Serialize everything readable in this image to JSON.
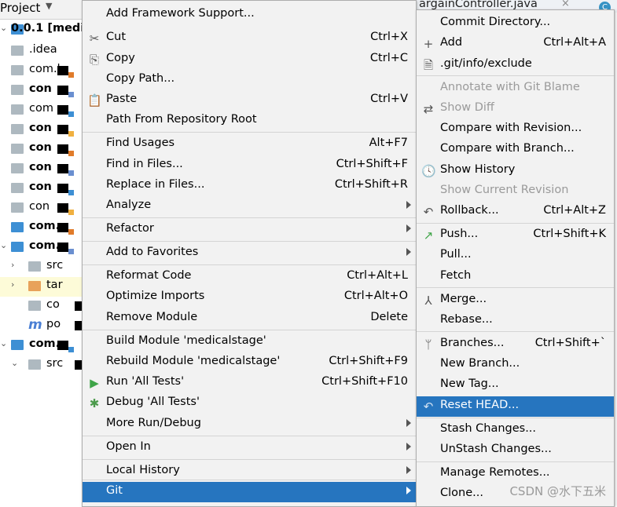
{
  "tree": {
    "title": "Project",
    "rows": [
      {
        "label": "0.0.1 [medic",
        "bold": true
      },
      {
        "label": ".idea"
      },
      {
        "label": "com.h"
      },
      {
        "label": "con",
        "bold": true
      },
      {
        "label": "com"
      },
      {
        "label": "con",
        "bold": true
      },
      {
        "label": "con",
        "bold": true
      },
      {
        "label": "con",
        "bold": true
      },
      {
        "label": "con",
        "bold": true
      },
      {
        "label": "con"
      },
      {
        "label": "com.",
        "bold": true
      },
      {
        "label": "com.",
        "bold": true
      },
      {
        "label": "src"
      },
      {
        "label": "tar"
      },
      {
        "label": "co"
      },
      {
        "label": "po"
      },
      {
        "label": "com.",
        "bold": true
      },
      {
        "label": "src"
      }
    ]
  },
  "editor": {
    "tab_title": "argainController.java",
    "tab_close": "×",
    "tab_badge": "C"
  },
  "main_menu": {
    "items": [
      {
        "label": "Add Framework Support...",
        "shortcut": ""
      },
      {
        "label": "Cut",
        "shortcut": "Ctrl+X",
        "icon": "scissors-icon",
        "glyph": "✂"
      },
      {
        "label": "Copy",
        "shortcut": "Ctrl+C",
        "icon": "copy-icon",
        "glyph": "⎘"
      },
      {
        "label": "Copy Path...",
        "shortcut": ""
      },
      {
        "label": "Paste",
        "shortcut": "Ctrl+V",
        "icon": "clipboard-icon",
        "glyph": "📋"
      },
      {
        "label": "Path From Repository Root",
        "shortcut": ""
      },
      {
        "label": "Find Usages",
        "shortcut": "Alt+F7"
      },
      {
        "label": "Find in Files...",
        "shortcut": "Ctrl+Shift+F"
      },
      {
        "label": "Replace in Files...",
        "shortcut": "Ctrl+Shift+R"
      },
      {
        "label": "Analyze",
        "shortcut": "",
        "submenu": true
      },
      {
        "label": "Refactor",
        "shortcut": "",
        "submenu": true
      },
      {
        "label": "Add to Favorites",
        "shortcut": "",
        "submenu": true
      },
      {
        "label": "Reformat Code",
        "shortcut": "Ctrl+Alt+L"
      },
      {
        "label": "Optimize Imports",
        "shortcut": "Ctrl+Alt+O"
      },
      {
        "label": "Remove Module",
        "shortcut": "Delete"
      },
      {
        "label": "Build Module 'medicalstage'",
        "shortcut": ""
      },
      {
        "label": "Rebuild Module 'medicalstage'",
        "shortcut": "Ctrl+Shift+F9"
      },
      {
        "label": "Run 'All Tests'",
        "shortcut": "Ctrl+Shift+F10",
        "icon": "run-icon",
        "glyph": "▶"
      },
      {
        "label": "Debug 'All Tests'",
        "shortcut": "",
        "icon": "debug-icon",
        "glyph": "✱"
      },
      {
        "label": "More Run/Debug",
        "shortcut": "",
        "submenu": true
      },
      {
        "label": "Open In",
        "shortcut": "",
        "submenu": true
      },
      {
        "label": "Local History",
        "shortcut": "",
        "submenu": true
      },
      {
        "label": "Git",
        "shortcut": "",
        "submenu": true,
        "selected": true
      }
    ]
  },
  "git_menu": {
    "items": [
      {
        "label": "Commit Directory...",
        "shortcut": ""
      },
      {
        "label": "Add",
        "shortcut": "Ctrl+Alt+A",
        "icon": "plus-icon",
        "glyph": "+"
      },
      {
        "label": ".git/info/exclude",
        "shortcut": "",
        "icon": "file-icon",
        "glyph": "🗎"
      },
      {
        "label": "Annotate with Git Blame",
        "shortcut": "",
        "disabled": true
      },
      {
        "label": "Show Diff",
        "shortcut": "",
        "disabled": true,
        "icon": "diff-icon",
        "glyph": "⇄"
      },
      {
        "label": "Compare with Revision...",
        "shortcut": ""
      },
      {
        "label": "Compare with Branch...",
        "shortcut": ""
      },
      {
        "label": "Show History",
        "shortcut": "",
        "icon": "clock-icon",
        "glyph": "🕓"
      },
      {
        "label": "Show Current Revision",
        "shortcut": "",
        "disabled": true
      },
      {
        "label": "Rollback...",
        "shortcut": "Ctrl+Alt+Z",
        "icon": "rollback-icon",
        "glyph": "↶"
      },
      {
        "label": "Push...",
        "shortcut": "Ctrl+Shift+K",
        "icon": "push-icon",
        "glyph": "↗"
      },
      {
        "label": "Pull...",
        "shortcut": ""
      },
      {
        "label": "Fetch",
        "shortcut": ""
      },
      {
        "label": "Merge...",
        "shortcut": "",
        "icon": "merge-icon",
        "glyph": "⅄"
      },
      {
        "label": "Rebase...",
        "shortcut": ""
      },
      {
        "label": "Branches...",
        "shortcut": "Ctrl+Shift+`",
        "icon": "branch-icon",
        "glyph": "ᛘ"
      },
      {
        "label": "New Branch...",
        "shortcut": ""
      },
      {
        "label": "New Tag...",
        "shortcut": ""
      },
      {
        "label": "Reset HEAD...",
        "shortcut": "",
        "selected": true,
        "icon": "reset-icon",
        "glyph": "↶"
      },
      {
        "label": "Stash Changes...",
        "shortcut": ""
      },
      {
        "label": "UnStash Changes...",
        "shortcut": ""
      },
      {
        "label": "Manage Remotes...",
        "shortcut": ""
      },
      {
        "label": "Clone...",
        "shortcut": ""
      }
    ]
  },
  "watermark": "CSDN @水下五米",
  "colors": {
    "selection": "#2675bf",
    "menu_bg": "#f2f2f2"
  }
}
